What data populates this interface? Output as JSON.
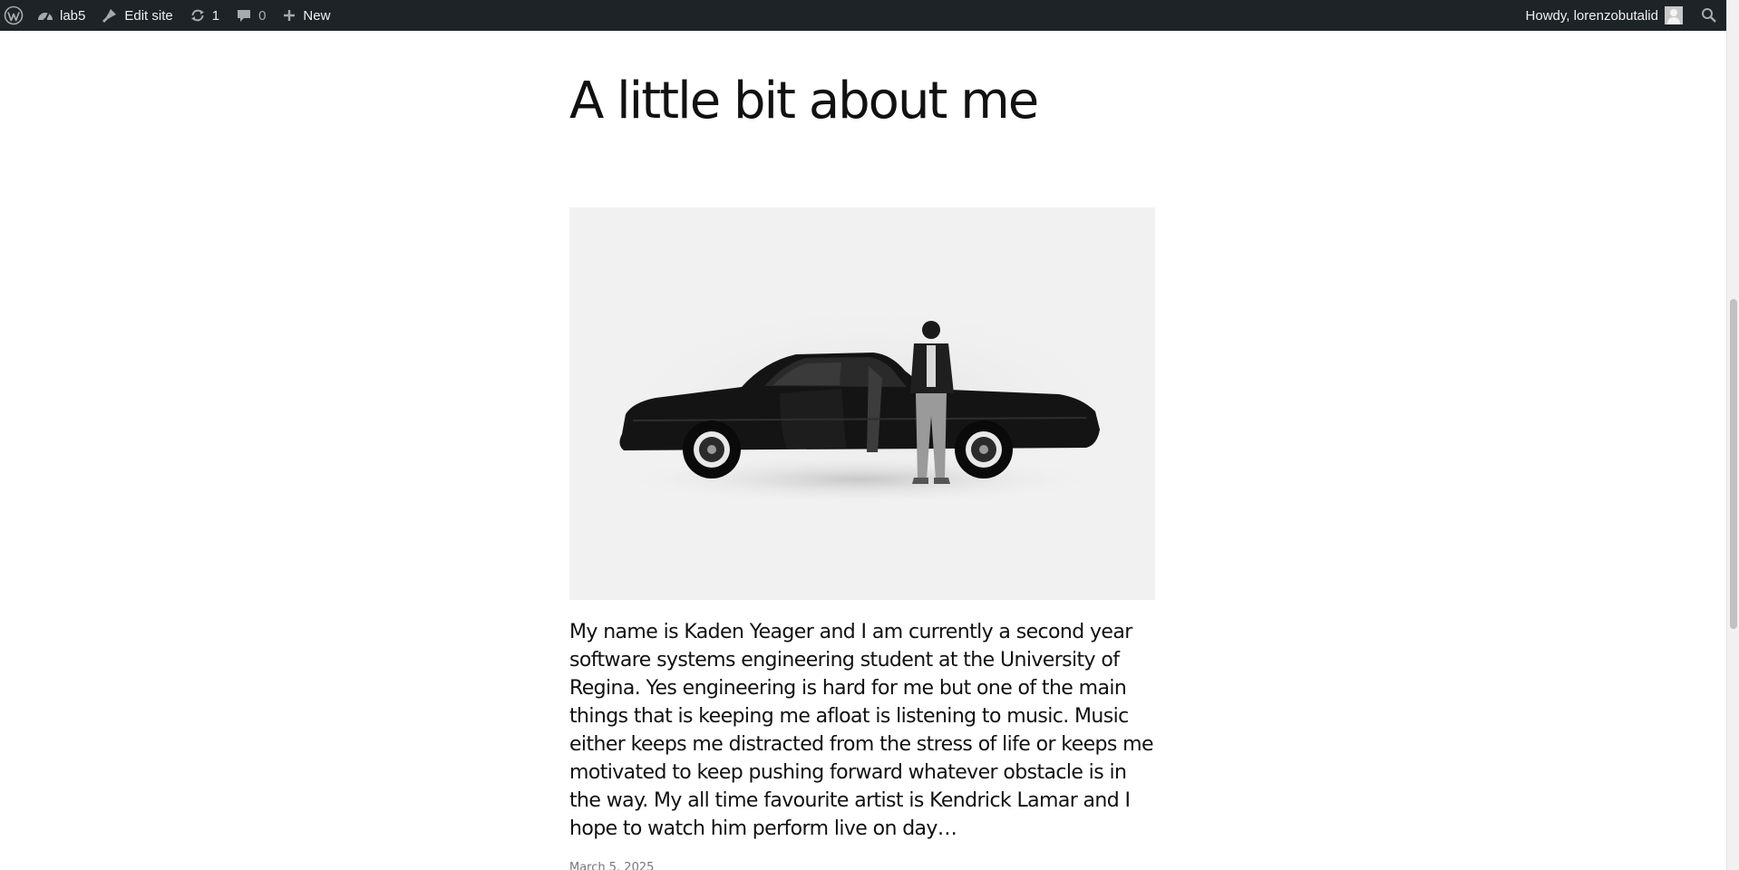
{
  "adminbar": {
    "site_name": "lab5",
    "edit_site": "Edit site",
    "updates_count": "1",
    "comments_count": "0",
    "new_label": "New",
    "howdy": "Howdy, lorenzobutalid"
  },
  "icons": {
    "wordpress": "wordpress-logo-icon",
    "site": "dashboard-icon",
    "edit": "brush-icon",
    "updates": "refresh-icon",
    "comments": "comment-bubble-icon",
    "new": "plus-icon",
    "search": "search-icon"
  },
  "page": {
    "title": "A little bit about me",
    "image_alt": "Black car with a man standing beside the open door",
    "bio": "My name is Kaden Yeager and I am currently a second year software systems engineering student at the University of Regina. Yes engineering is hard for me but one of the main things that is keeping me afloat is listening to music. Music either keeps me distracted from the stress of life or keeps me motivated to keep pushing forward whatever obstacle is in the way. My all time favourite artist is Kendrick Lamar and I hope to watch him perform live on day…",
    "date": "March 5, 2025"
  },
  "colors": {
    "adminbar_bg": "#1d2327",
    "adminbar_text": "#f0f0f1",
    "image_bg": "#f1f1f1"
  }
}
